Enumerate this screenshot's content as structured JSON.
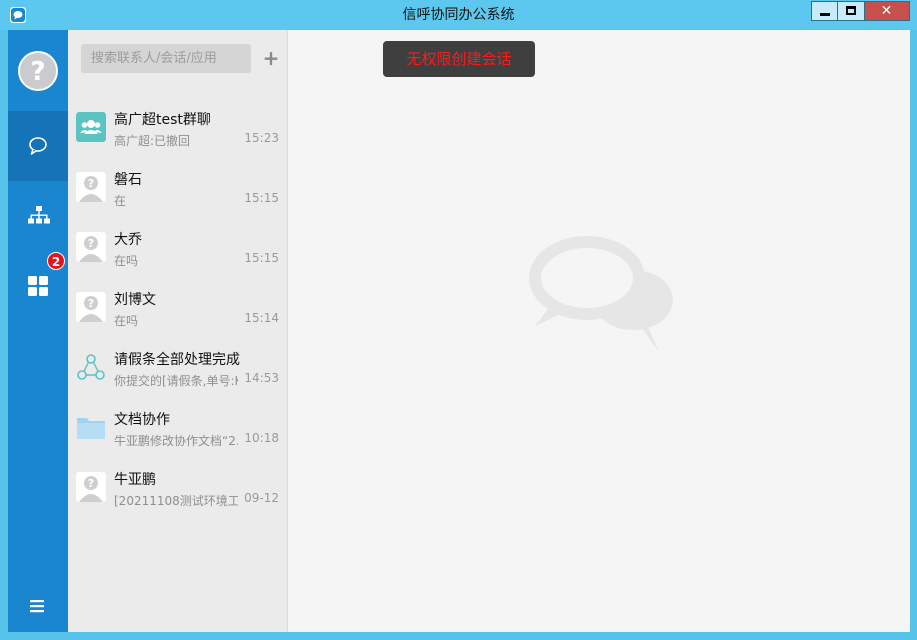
{
  "window": {
    "title": "信呼协同办公系统"
  },
  "colors": {
    "sidebar": "#1a86d0",
    "titlebar": "#5cc8ef",
    "badge": "#e8111b",
    "toast_text": "#ff1a1a"
  },
  "nav": {
    "avatar_icon": "default-avatar",
    "items": [
      {
        "name": "chat",
        "icon": "chat-bubble-icon",
        "active": true
      },
      {
        "name": "org",
        "icon": "org-chart-icon"
      },
      {
        "name": "apps",
        "icon": "grid-icon",
        "badge": "2"
      }
    ],
    "menu_icon": "hamburger-icon"
  },
  "search": {
    "placeholder": "搜索联系人/会话/应用",
    "add_label": "+"
  },
  "conversations": [
    {
      "name": "高广超test群聊",
      "preview": "高广超:已撤回",
      "time": "15:23",
      "icon": "group-icon"
    },
    {
      "name": "磐石",
      "preview": "在",
      "time": "15:15",
      "icon": "default-avatar"
    },
    {
      "name": "大乔",
      "preview": "在吗",
      "time": "15:15",
      "icon": "default-avatar"
    },
    {
      "name": "刘博文",
      "preview": "在吗",
      "time": "15:14",
      "icon": "default-avatar"
    },
    {
      "name": "请假条全部处理完成",
      "preview": "你提交的[请假条,单号:KA",
      "time": "14:53",
      "icon": "flow-icon"
    },
    {
      "name": "文档协作",
      "preview": "牛亚鹏修改协作文档“2.",
      "time": "10:18",
      "icon": "folder-icon"
    },
    {
      "name": "牛亚鹏",
      "preview": "[20211108测试环境工",
      "time": "09-12",
      "icon": "default-avatar"
    }
  ],
  "toast": {
    "text": "无权限创建会话"
  }
}
